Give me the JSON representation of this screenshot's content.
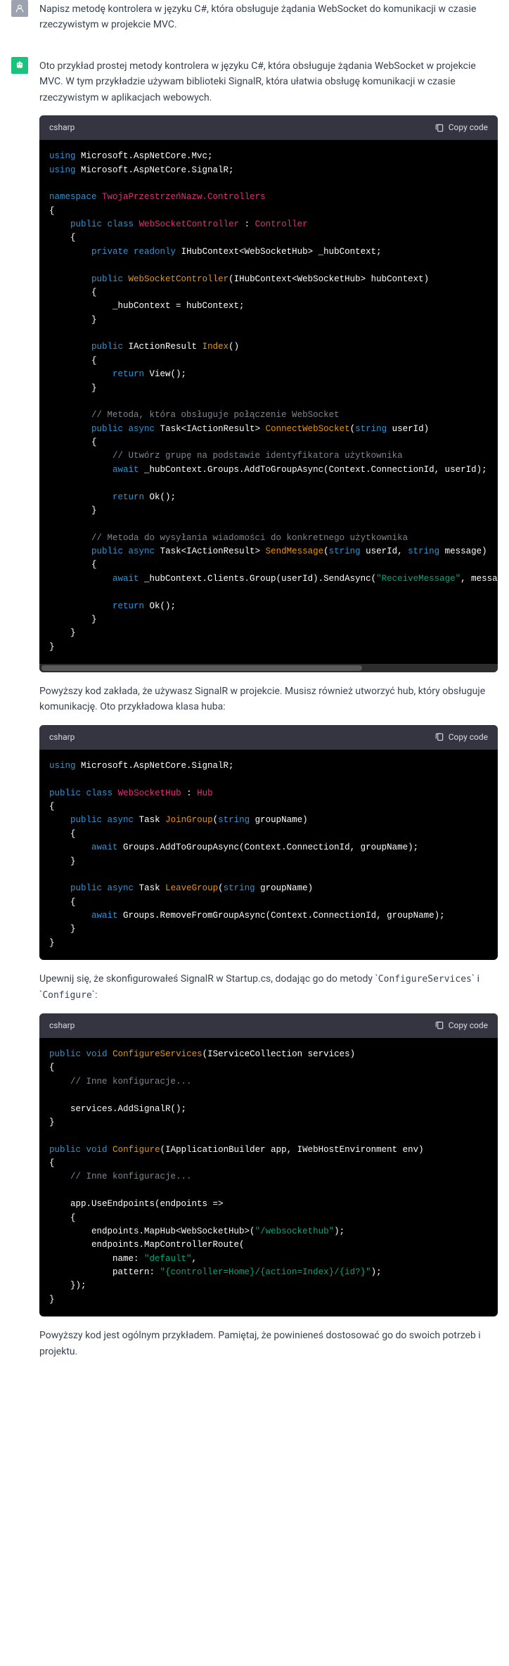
{
  "user": {
    "text": "Napisz metodę kontrolera w języku C#, która obsługuje żądania WebSocket do komunikacji w czasie rzeczywistym w projekcie MVC."
  },
  "ai": {
    "intro": "Oto przykład prostej metody kontrolera w języku C#, która obsługuje żądania WebSocket w projekcie MVC. W tym przykładzie używam biblioteki SignalR, która ułatwia obsługę komunikacji w czasie rzeczywistym w aplikacjach webowych.",
    "mid1": "Powyższy kod zakłada, że używasz SignalR w projekcie. Musisz również utworzyć hub, który obsługuje komunikację. Oto przykładowa klasa huba:",
    "mid2a": "Upewnij się, że skonfigurowałeś SignalR w Startup.cs, dodając go do metody ",
    "mid2b": "ConfigureServices",
    "mid2c": " i ",
    "mid2d": "Configure",
    "mid2e": ":",
    "outro": "Powyższy kod jest ogólnym przykładem. Pamiętaj, że powinieneś dostosować go do swoich potrzeb i projektu."
  },
  "code_header": {
    "lang": "csharp",
    "copy": "Copy code"
  }
}
